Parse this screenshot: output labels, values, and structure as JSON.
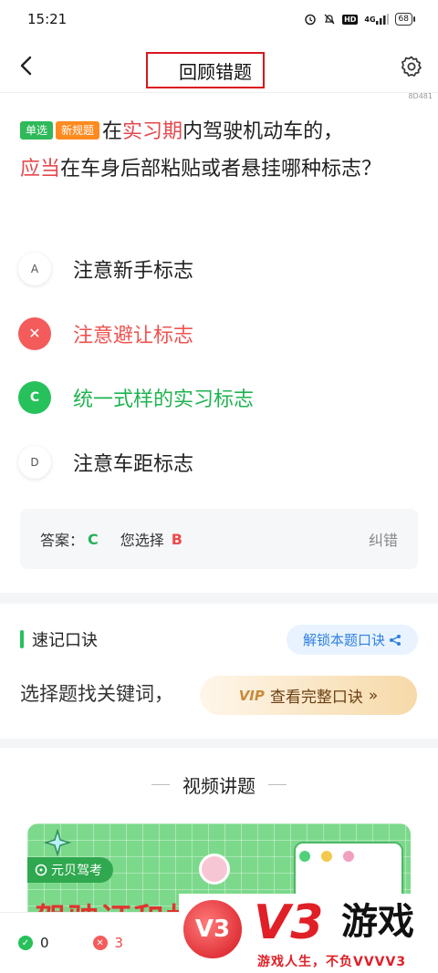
{
  "status_bar": {
    "time": "15:21",
    "hd": "HD",
    "network": "4G",
    "battery": "68"
  },
  "header": {
    "title": "回顾错题",
    "question_id": "8D481"
  },
  "question": {
    "tag_type": "单选",
    "tag_new": "新规题",
    "text_before": "在",
    "text_hl1": "实习期",
    "text_mid": "内驾驶机动车的，",
    "text_hl2": "应当",
    "text_after": "在车身后部粘贴或者悬挂哪种标志？"
  },
  "options": [
    {
      "badge": "A",
      "text": "注意新手标志",
      "state": "normal"
    },
    {
      "badge": "✕",
      "text": "注意避让标志",
      "state": "wrong"
    },
    {
      "badge": "C",
      "text": "统一式样的实习标志",
      "state": "correct"
    },
    {
      "badge": "D",
      "text": "注意车距标志",
      "state": "normal"
    }
  ],
  "answer": {
    "answer_label": "答案：",
    "answer_value": "C",
    "choice_label": "您选择",
    "choice_value": "B",
    "correction": "纠错"
  },
  "mnemonic": {
    "title": "速记口诀",
    "unlock_label": "解锁本题口诀",
    "preview": "选择题找关键词，",
    "vip_mark": "VIP",
    "vip_label": "查看完整口诀",
    "vip_arrow": "»"
  },
  "video": {
    "title": "视频讲题",
    "brand": "元贝驾考",
    "banner_text": "驾驶证和机"
  },
  "footer": {
    "correct_count": "0",
    "wrong_count": "3"
  },
  "watermark": {
    "logo": "V3",
    "big": "V3",
    "game": "游戏",
    "slogan": "游戏人生，不负VVVV3"
  },
  "colors": {
    "accent_green": "#27c15b",
    "error_red": "#f45b5b",
    "highlight": "#e5484d",
    "link_blue": "#2f7fe0"
  }
}
